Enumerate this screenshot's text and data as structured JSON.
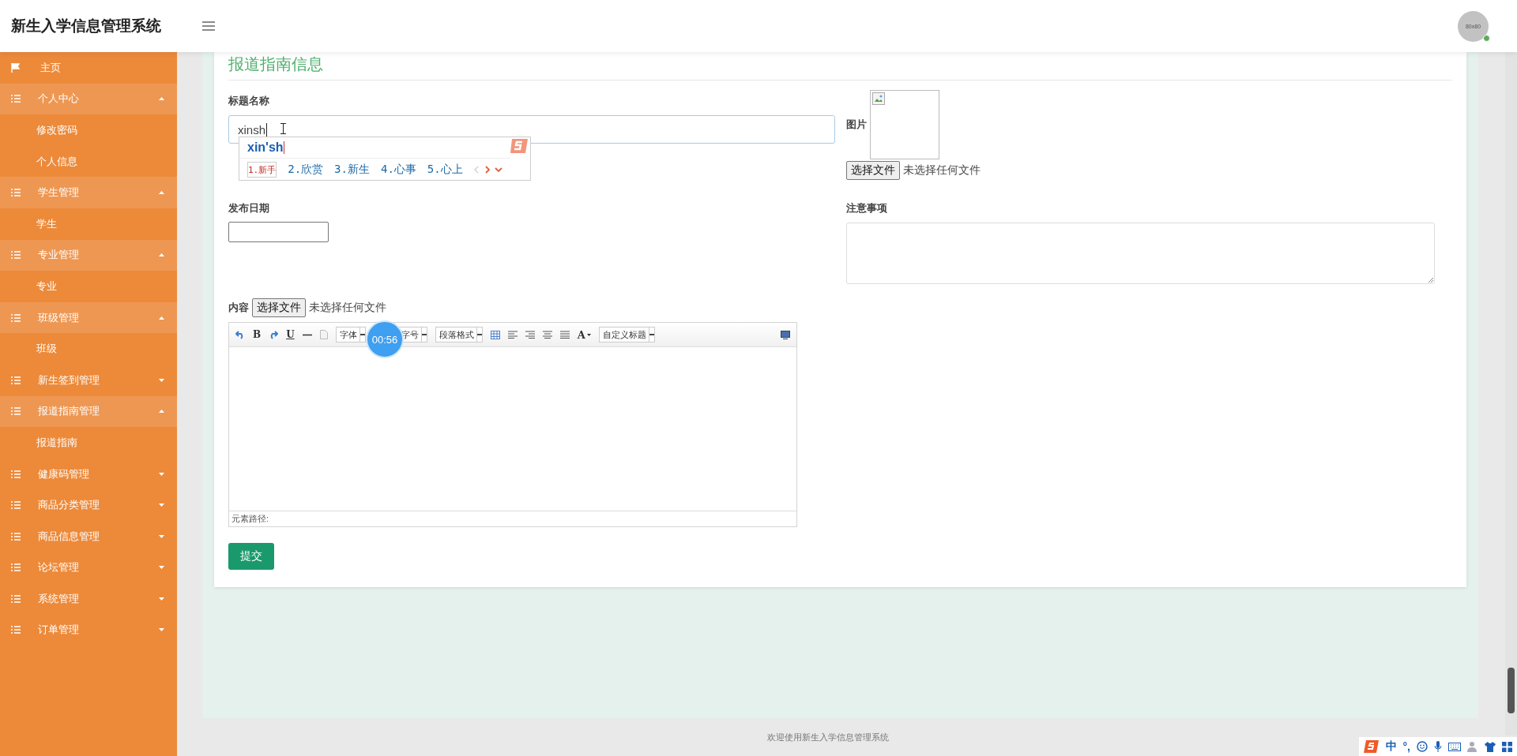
{
  "header": {
    "title": "新生入学信息管理系统",
    "avatar_text": "80x80",
    "online": true
  },
  "sidebar": {
    "items": [
      {
        "label": "主页",
        "kind": "link"
      },
      {
        "label": "个人中心",
        "kind": "group",
        "expanded": true,
        "children": [
          {
            "label": "修改密码"
          },
          {
            "label": "个人信息"
          }
        ]
      },
      {
        "label": "学生管理",
        "kind": "group",
        "expanded": true,
        "children": [
          {
            "label": "学生"
          }
        ]
      },
      {
        "label": "专业管理",
        "kind": "group",
        "expanded": true,
        "children": [
          {
            "label": "专业"
          }
        ]
      },
      {
        "label": "班级管理",
        "kind": "group",
        "expanded": true,
        "children": [
          {
            "label": "班级"
          }
        ]
      },
      {
        "label": "新生签到管理",
        "kind": "group",
        "expanded": false
      },
      {
        "label": "报道指南管理",
        "kind": "group",
        "expanded": true,
        "children": [
          {
            "label": "报道指南"
          }
        ]
      },
      {
        "label": "健康码管理",
        "kind": "group",
        "expanded": false
      },
      {
        "label": "商品分类管理",
        "kind": "group",
        "expanded": false
      },
      {
        "label": "商品信息管理",
        "kind": "group",
        "expanded": false
      },
      {
        "label": "论坛管理",
        "kind": "group",
        "expanded": false
      },
      {
        "label": "系统管理",
        "kind": "group",
        "expanded": false
      },
      {
        "label": "订单管理",
        "kind": "group",
        "expanded": false
      }
    ]
  },
  "form": {
    "title": "报道指南信息",
    "title_field": {
      "label": "标题名称",
      "value": "xinsh"
    },
    "ime": {
      "composition": "xin'sh",
      "candidates": [
        {
          "label": "1.新手",
          "selected": true
        },
        {
          "label": "2.欣赏",
          "selected": false
        },
        {
          "label": "3.新生",
          "selected": false
        },
        {
          "label": "4.心事",
          "selected": false
        },
        {
          "label": "5.心上",
          "selected": false
        }
      ]
    },
    "image": {
      "label": "图片",
      "button": "选择文件",
      "status": "未选择任何文件"
    },
    "date_field": {
      "label": "发布日期"
    },
    "notes_field": {
      "label": "注意事项"
    },
    "content": {
      "label": "内容",
      "button": "选择文件",
      "status": "未选择任何文件",
      "toolbar": [
        {
          "kind": "undo"
        },
        {
          "kind": "glyph",
          "label": "B"
        },
        {
          "kind": "redo"
        },
        {
          "kind": "glyph",
          "label": "U",
          "underline": true
        },
        {
          "kind": "rule"
        },
        {
          "kind": "page"
        },
        {
          "kind": "select",
          "label": "字体"
        },
        {
          "kind": "select",
          "label": "字号"
        },
        {
          "kind": "select",
          "label": "段落格式"
        },
        {
          "kind": "table"
        },
        {
          "kind": "align-left"
        },
        {
          "kind": "align-right"
        },
        {
          "kind": "align-center"
        },
        {
          "kind": "justify"
        },
        {
          "kind": "color",
          "label": "A"
        },
        {
          "kind": "select",
          "label": "自定义标题"
        },
        {
          "kind": "spacer"
        },
        {
          "kind": "preview"
        }
      ],
      "status_bar": "元素路径:"
    },
    "submit": "提交"
  },
  "timer": "00:56",
  "footer": "欢迎使用新生入学信息管理系统",
  "ime_bar": {
    "mode": "中",
    "punctuation": "°,"
  }
}
